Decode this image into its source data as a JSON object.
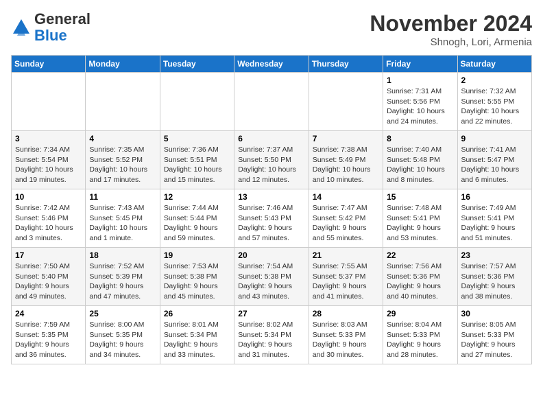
{
  "header": {
    "logo_line1": "General",
    "logo_line2": "Blue",
    "month": "November 2024",
    "location": "Shnogh, Lori, Armenia"
  },
  "days_of_week": [
    "Sunday",
    "Monday",
    "Tuesday",
    "Wednesday",
    "Thursday",
    "Friday",
    "Saturday"
  ],
  "weeks": [
    [
      {
        "day": "",
        "info": ""
      },
      {
        "day": "",
        "info": ""
      },
      {
        "day": "",
        "info": ""
      },
      {
        "day": "",
        "info": ""
      },
      {
        "day": "",
        "info": ""
      },
      {
        "day": "1",
        "info": "Sunrise: 7:31 AM\nSunset: 5:56 PM\nDaylight: 10 hours and 24 minutes."
      },
      {
        "day": "2",
        "info": "Sunrise: 7:32 AM\nSunset: 5:55 PM\nDaylight: 10 hours and 22 minutes."
      }
    ],
    [
      {
        "day": "3",
        "info": "Sunrise: 7:34 AM\nSunset: 5:54 PM\nDaylight: 10 hours and 19 minutes."
      },
      {
        "day": "4",
        "info": "Sunrise: 7:35 AM\nSunset: 5:52 PM\nDaylight: 10 hours and 17 minutes."
      },
      {
        "day": "5",
        "info": "Sunrise: 7:36 AM\nSunset: 5:51 PM\nDaylight: 10 hours and 15 minutes."
      },
      {
        "day": "6",
        "info": "Sunrise: 7:37 AM\nSunset: 5:50 PM\nDaylight: 10 hours and 12 minutes."
      },
      {
        "day": "7",
        "info": "Sunrise: 7:38 AM\nSunset: 5:49 PM\nDaylight: 10 hours and 10 minutes."
      },
      {
        "day": "8",
        "info": "Sunrise: 7:40 AM\nSunset: 5:48 PM\nDaylight: 10 hours and 8 minutes."
      },
      {
        "day": "9",
        "info": "Sunrise: 7:41 AM\nSunset: 5:47 PM\nDaylight: 10 hours and 6 minutes."
      }
    ],
    [
      {
        "day": "10",
        "info": "Sunrise: 7:42 AM\nSunset: 5:46 PM\nDaylight: 10 hours and 3 minutes."
      },
      {
        "day": "11",
        "info": "Sunrise: 7:43 AM\nSunset: 5:45 PM\nDaylight: 10 hours and 1 minute."
      },
      {
        "day": "12",
        "info": "Sunrise: 7:44 AM\nSunset: 5:44 PM\nDaylight: 9 hours and 59 minutes."
      },
      {
        "day": "13",
        "info": "Sunrise: 7:46 AM\nSunset: 5:43 PM\nDaylight: 9 hours and 57 minutes."
      },
      {
        "day": "14",
        "info": "Sunrise: 7:47 AM\nSunset: 5:42 PM\nDaylight: 9 hours and 55 minutes."
      },
      {
        "day": "15",
        "info": "Sunrise: 7:48 AM\nSunset: 5:41 PM\nDaylight: 9 hours and 53 minutes."
      },
      {
        "day": "16",
        "info": "Sunrise: 7:49 AM\nSunset: 5:41 PM\nDaylight: 9 hours and 51 minutes."
      }
    ],
    [
      {
        "day": "17",
        "info": "Sunrise: 7:50 AM\nSunset: 5:40 PM\nDaylight: 9 hours and 49 minutes."
      },
      {
        "day": "18",
        "info": "Sunrise: 7:52 AM\nSunset: 5:39 PM\nDaylight: 9 hours and 47 minutes."
      },
      {
        "day": "19",
        "info": "Sunrise: 7:53 AM\nSunset: 5:38 PM\nDaylight: 9 hours and 45 minutes."
      },
      {
        "day": "20",
        "info": "Sunrise: 7:54 AM\nSunset: 5:38 PM\nDaylight: 9 hours and 43 minutes."
      },
      {
        "day": "21",
        "info": "Sunrise: 7:55 AM\nSunset: 5:37 PM\nDaylight: 9 hours and 41 minutes."
      },
      {
        "day": "22",
        "info": "Sunrise: 7:56 AM\nSunset: 5:36 PM\nDaylight: 9 hours and 40 minutes."
      },
      {
        "day": "23",
        "info": "Sunrise: 7:57 AM\nSunset: 5:36 PM\nDaylight: 9 hours and 38 minutes."
      }
    ],
    [
      {
        "day": "24",
        "info": "Sunrise: 7:59 AM\nSunset: 5:35 PM\nDaylight: 9 hours and 36 minutes."
      },
      {
        "day": "25",
        "info": "Sunrise: 8:00 AM\nSunset: 5:35 PM\nDaylight: 9 hours and 34 minutes."
      },
      {
        "day": "26",
        "info": "Sunrise: 8:01 AM\nSunset: 5:34 PM\nDaylight: 9 hours and 33 minutes."
      },
      {
        "day": "27",
        "info": "Sunrise: 8:02 AM\nSunset: 5:34 PM\nDaylight: 9 hours and 31 minutes."
      },
      {
        "day": "28",
        "info": "Sunrise: 8:03 AM\nSunset: 5:33 PM\nDaylight: 9 hours and 30 minutes."
      },
      {
        "day": "29",
        "info": "Sunrise: 8:04 AM\nSunset: 5:33 PM\nDaylight: 9 hours and 28 minutes."
      },
      {
        "day": "30",
        "info": "Sunrise: 8:05 AM\nSunset: 5:33 PM\nDaylight: 9 hours and 27 minutes."
      }
    ]
  ]
}
